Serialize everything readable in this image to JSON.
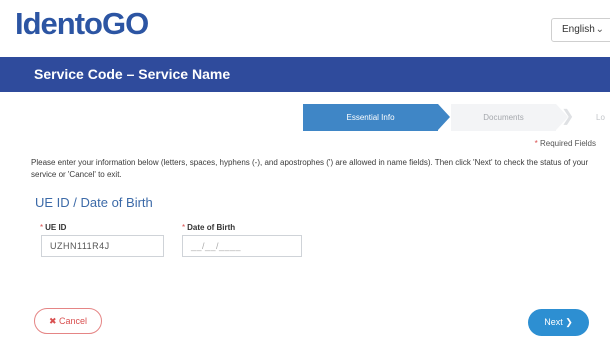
{
  "header": {
    "logo_text": "IdentoGO",
    "language": "English",
    "language_chevron": "⌄"
  },
  "title_bar": {
    "title": "Service Code – Service Name"
  },
  "steps": [
    {
      "label": "Essential Info",
      "state": "active"
    },
    {
      "label": "Documents",
      "state": "inactive"
    },
    {
      "label": "Lo",
      "state": "inactive"
    }
  ],
  "form": {
    "required_note": "Required Fields",
    "required_star": "*",
    "instructions": "Please enter your information below (letters, spaces, hyphens (-), and apostrophes (') are allowed in name fields). Then click 'Next' to check the status of your service or 'Cancel' to exit.",
    "section_title": "UE ID / Date of Birth",
    "ue_id": {
      "label": "UE ID",
      "value": "UZHN111R4J"
    },
    "dob": {
      "label": "Date of Birth",
      "placeholder": "__/__/____"
    }
  },
  "actions": {
    "cancel_label": "Cancel",
    "cancel_icon": "✖",
    "next_label": "Next",
    "next_icon": "❯"
  },
  "colors": {
    "brand_blue": "#2c55a3",
    "title_bar": "#2f4b9c",
    "step_active": "#3f86c6",
    "next_button": "#2d8fd2",
    "cancel_red": "#d95050"
  }
}
